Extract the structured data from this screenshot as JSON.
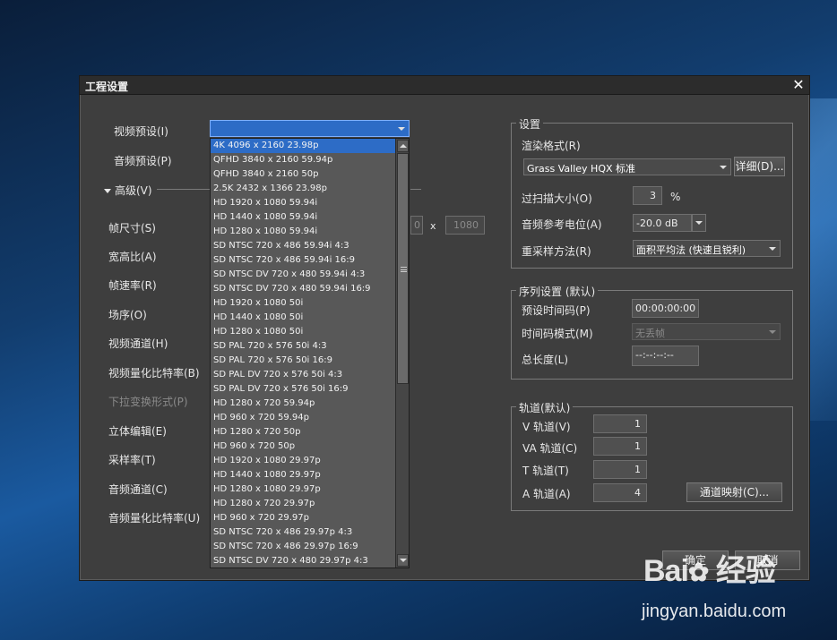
{
  "window": {
    "title": "工程设置",
    "close_glyph": "✕"
  },
  "left": {
    "video_preset_label": "视频预设(I)",
    "audio_preset_label": "音频预设(P)",
    "advanced_label": "高级(V)",
    "frame_size_label": "帧尺寸(S)",
    "frame_size_sep": "x",
    "frame_width": "0",
    "frame_height": "1080",
    "aspect_label": "宽高比(A)",
    "frame_rate_label": "帧速率(R)",
    "field_order_label": "场序(O)",
    "video_channel_label": "视频通道(H)",
    "video_quant_label": "视频量化比特率(B)",
    "pulldown_label": "下拉变换形式(P)",
    "stereo_label": "立体编辑(E)",
    "sample_rate_label": "采样率(T)",
    "audio_channel_label": "音频通道(C)",
    "audio_quant_label": "音频量化比特率(U)",
    "video_preset_value": ""
  },
  "preset_list": {
    "selected_index": 0,
    "items": [
      "4K 4096 x 2160 23.98p",
      "QFHD 3840 x 2160 59.94p",
      "QFHD 3840 x 2160 50p",
      "2.5K 2432 x 1366 23.98p",
      "HD 1920 x 1080 59.94i",
      "HD 1440 x 1080 59.94i",
      "HD 1280 x 1080 59.94i",
      "SD NTSC 720 x 486 59.94i 4:3",
      "SD NTSC 720 x 486 59.94i 16:9",
      "SD NTSC DV 720 x 480 59.94i 4:3",
      "SD NTSC DV 720 x 480 59.94i 16:9",
      "HD 1920 x 1080 50i",
      "HD 1440 x 1080 50i",
      "HD 1280 x 1080 50i",
      "SD PAL 720 x 576 50i 4:3",
      "SD PAL 720 x 576 50i 16:9",
      "SD PAL DV 720 x 576 50i 4:3",
      "SD PAL DV 720 x 576 50i 16:9",
      "HD 1280 x 720 59.94p",
      "HD 960 x 720 59.94p",
      "HD 1280 x 720 50p",
      "HD 960 x 720 50p",
      "HD 1920 x 1080 29.97p",
      "HD 1440 x 1080 29.97p",
      "HD 1280 x 1080 29.97p",
      "HD 1280 x 720 29.97p",
      "HD 960 x 720 29.97p",
      "SD NTSC 720 x 486 29.97p 4:3",
      "SD NTSC 720 x 486 29.97p 16:9",
      "SD NTSC DV 720 x 480 29.97p 4:3"
    ]
  },
  "settings": {
    "group_title": "设置",
    "render_format_label": "渲染格式(R)",
    "render_format_value": "Grass Valley HQX 标准",
    "details_button": "详细(D)...",
    "overscan_label": "过扫描大小(O)",
    "overscan_value": "3",
    "overscan_unit": "%",
    "audio_ref_label": "音频参考电位(A)",
    "audio_ref_value": "-20.0 dB",
    "resample_label": "重采样方法(R)",
    "resample_value": "面积平均法 (快速且锐利)"
  },
  "sequence": {
    "group_title": "序列设置 (默认)",
    "timecode_preset_label": "预设时间码(P)",
    "timecode_preset_value": "00:00:00:00",
    "timecode_mode_label": "时间码模式(M)",
    "timecode_mode_value": "无丢帧",
    "total_length_label": "总长度(L)",
    "total_length_value": "--:--:--:--"
  },
  "tracks": {
    "group_title": "轨道(默认)",
    "v_label": "V 轨道(V)",
    "v_value": "1",
    "va_label": "VA 轨道(C)",
    "va_value": "1",
    "t_label": "T 轨道(T)",
    "t_value": "1",
    "a_label": "A 轨道(A)",
    "a_value": "4",
    "channel_map_button": "通道映射(C)..."
  },
  "footer": {
    "ok_button": "确定",
    "cancel_button": "取消"
  },
  "watermark": {
    "logo": "Bai 经验",
    "url": "jingyan.baidu.com"
  }
}
